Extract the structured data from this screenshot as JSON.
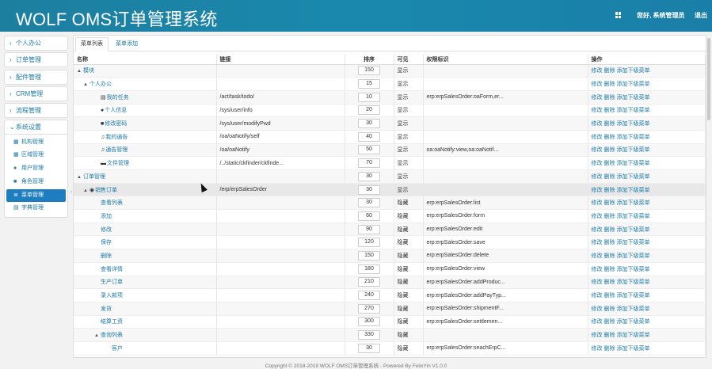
{
  "header": {
    "title": "WOLF OMS订单管理系统",
    "greeting": "您好, 系统管理员",
    "logout": "退出"
  },
  "sidebar": {
    "groups": [
      {
        "label": "个人办公"
      },
      {
        "label": "订单管理"
      },
      {
        "label": "配件管理"
      },
      {
        "label": "CRM管理"
      },
      {
        "label": "流程管理"
      },
      {
        "label": "系统设置"
      }
    ],
    "sub_items": [
      {
        "label": "机构管理",
        "icon": "grid-icon"
      },
      {
        "label": "区域管理",
        "icon": "grid-icon"
      },
      {
        "label": "用户管理",
        "icon": "user-icon"
      },
      {
        "label": "角色管理",
        "icon": "lock-icon"
      },
      {
        "label": "菜单管理",
        "icon": "list-icon"
      },
      {
        "label": "字典管理",
        "icon": "table-icon"
      }
    ]
  },
  "tabs": [
    {
      "label": "菜单列表"
    },
    {
      "label": "菜单添加"
    }
  ],
  "table": {
    "headers": [
      "名称",
      "链接",
      "排序",
      "可见",
      "权限标识",
      "操作"
    ],
    "ops": {
      "edit": "修改",
      "delete": "删除",
      "add_child": "添加下级菜单"
    },
    "rows": [
      {
        "name": "模块",
        "link": "",
        "sort": "150",
        "visible": "显示",
        "perm": ""
      },
      {
        "name": "个人办公",
        "link": "",
        "sort": "15",
        "visible": "显示",
        "perm": ""
      },
      {
        "name": "我的任务",
        "link": "/act/task/todo/",
        "sort": "10",
        "visible": "显示",
        "perm": "erp:erpSalesOrder:oaForm,er..."
      },
      {
        "name": "个人信息",
        "link": "/sys/user/info",
        "sort": "20",
        "visible": "显示",
        "perm": ""
      },
      {
        "name": "修改密码",
        "link": "/sys/user/modifyPwd",
        "sort": "30",
        "visible": "显示",
        "perm": ""
      },
      {
        "name": "我的通告",
        "link": "/oa/oaNotify/self",
        "sort": "40",
        "visible": "显示",
        "perm": ""
      },
      {
        "name": "通告管理",
        "link": "/oa/oaNotify",
        "sort": "50",
        "visible": "显示",
        "perm": "oa:oaNotify:view,oa:oaNotif..."
      },
      {
        "name": "文件管理",
        "link": "/../static/ckfinder/ckfinde...",
        "sort": "70",
        "visible": "显示",
        "perm": ""
      },
      {
        "name": "订单管理",
        "link": "",
        "sort": "30",
        "visible": "显示",
        "perm": ""
      },
      {
        "name": "销售订单",
        "link": "/erp/erpSalesOrder",
        "sort": "30",
        "visible": "显示",
        "perm": ""
      },
      {
        "name": "查看列表",
        "link": "",
        "sort": "30",
        "visible": "隐藏",
        "perm": "erp:erpSalesOrder:list"
      },
      {
        "name": "添加",
        "link": "",
        "sort": "60",
        "visible": "隐藏",
        "perm": "erp:erpSalesOrder:form"
      },
      {
        "name": "修改",
        "link": "",
        "sort": "90",
        "visible": "隐藏",
        "perm": "erp:erpSalesOrder:edit"
      },
      {
        "name": "保存",
        "link": "",
        "sort": "120",
        "visible": "隐藏",
        "perm": "erp:erpSalesOrder:save"
      },
      {
        "name": "删除",
        "link": "",
        "sort": "150",
        "visible": "隐藏",
        "perm": "erp:erpSalesOrder:delete"
      },
      {
        "name": "查看详情",
        "link": "",
        "sort": "180",
        "visible": "隐藏",
        "perm": "erp:erpSalesOrder:view"
      },
      {
        "name": "生产订单",
        "link": "",
        "sort": "210",
        "visible": "隐藏",
        "perm": "erp:erpSalesOrder:addProduc..."
      },
      {
        "name": "录入款项",
        "link": "",
        "sort": "240",
        "visible": "隐藏",
        "perm": "erp:erpSalesOrder:addPayTyp..."
      },
      {
        "name": "发货",
        "link": "",
        "sort": "270",
        "visible": "隐藏",
        "perm": "erp:erpSalesOrder:shipmentF..."
      },
      {
        "name": "结算工资",
        "link": "",
        "sort": "300",
        "visible": "隐藏",
        "perm": "erp:erpSalesOrder:settlemen..."
      },
      {
        "name": "查询列表",
        "link": "",
        "sort": "330",
        "visible": "隐藏",
        "perm": ""
      },
      {
        "name": "客户",
        "link": "",
        "sort": "30",
        "visible": "隐藏",
        "perm": "erp:erpSalesOrder:seachErpC..."
      }
    ]
  },
  "footer": "Copyright © 2018-2019 WOLF OMS订单管理系统 - Powered By FelixYin V1.0.0"
}
